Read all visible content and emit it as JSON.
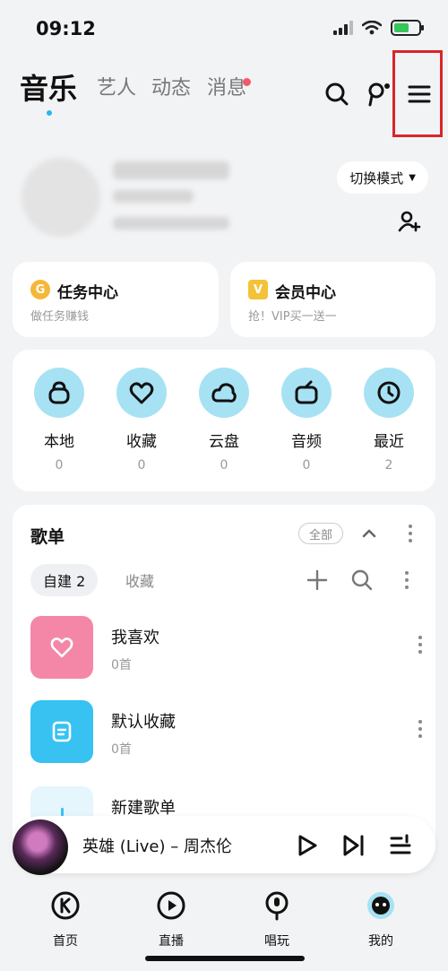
{
  "status_bar": {
    "time": "09:12"
  },
  "top_nav": {
    "tabs": [
      {
        "label": "音乐",
        "active": true
      },
      {
        "label": "艺人",
        "active": false
      },
      {
        "label": "动态",
        "active": false
      },
      {
        "label": "消息",
        "active": false
      }
    ]
  },
  "profile": {
    "mode_button_label": "切换模式"
  },
  "task_card": {
    "title": "任务中心",
    "subtitle": "做任务赚钱",
    "icon_letter": "G"
  },
  "vip_card": {
    "title": "会员中心",
    "subtitle": "抢！VIP买一送一",
    "icon_letter": "V"
  },
  "quick_access": [
    {
      "label": "本地",
      "count": "0",
      "icon": "bag-icon"
    },
    {
      "label": "收藏",
      "count": "0",
      "icon": "heart-icon"
    },
    {
      "label": "云盘",
      "count": "0",
      "icon": "cloud-icon"
    },
    {
      "label": "音频",
      "count": "0",
      "icon": "radio-icon"
    },
    {
      "label": "最近",
      "count": "2",
      "icon": "clock-icon"
    }
  ],
  "playlists": {
    "title": "歌单",
    "all_label": "全部",
    "subtab_active": "自建 2",
    "subtab_inactive": "收藏",
    "items": [
      {
        "name": "我喜欢",
        "count": "0首",
        "color": "#f487a8"
      },
      {
        "name": "默认收藏",
        "count": "0首",
        "color": "#37c2f2"
      },
      {
        "name": "新建歌单",
        "count": "",
        "color": "#e5f6fd"
      }
    ]
  },
  "mini_player": {
    "title": "英雄 (Live) – 周杰伦"
  },
  "bottom_nav": [
    {
      "label": "首页"
    },
    {
      "label": "直播"
    },
    {
      "label": "唱玩"
    },
    {
      "label": "我的"
    }
  ],
  "colors": {
    "accent": "#21b9f2",
    "highlight": "#d9262a",
    "icon_circle": "#a6e2f4"
  }
}
